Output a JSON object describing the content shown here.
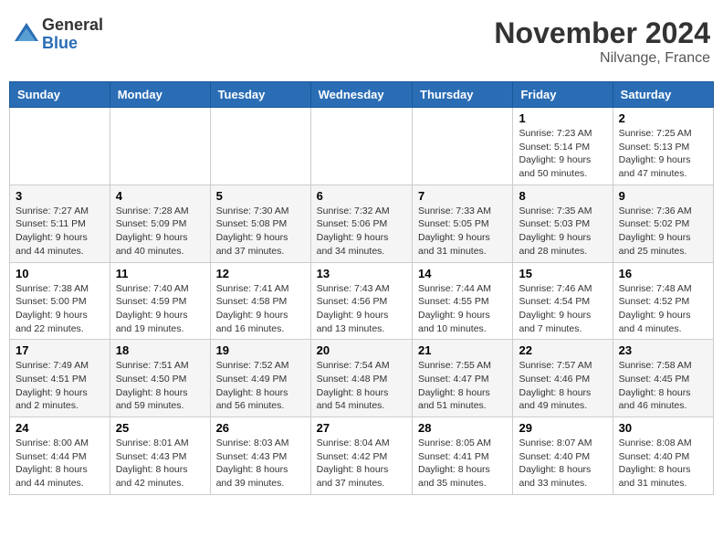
{
  "logo": {
    "general": "General",
    "blue": "Blue"
  },
  "title": "November 2024",
  "location": "Nilvange, France",
  "weekdays": [
    "Sunday",
    "Monday",
    "Tuesday",
    "Wednesday",
    "Thursday",
    "Friday",
    "Saturday"
  ],
  "weeks": [
    [
      null,
      null,
      null,
      null,
      null,
      {
        "day": "1",
        "sunrise": "Sunrise: 7:23 AM",
        "sunset": "Sunset: 5:14 PM",
        "daylight": "Daylight: 9 hours and 50 minutes."
      },
      {
        "day": "2",
        "sunrise": "Sunrise: 7:25 AM",
        "sunset": "Sunset: 5:13 PM",
        "daylight": "Daylight: 9 hours and 47 minutes."
      }
    ],
    [
      {
        "day": "3",
        "sunrise": "Sunrise: 7:27 AM",
        "sunset": "Sunset: 5:11 PM",
        "daylight": "Daylight: 9 hours and 44 minutes."
      },
      {
        "day": "4",
        "sunrise": "Sunrise: 7:28 AM",
        "sunset": "Sunset: 5:09 PM",
        "daylight": "Daylight: 9 hours and 40 minutes."
      },
      {
        "day": "5",
        "sunrise": "Sunrise: 7:30 AM",
        "sunset": "Sunset: 5:08 PM",
        "daylight": "Daylight: 9 hours and 37 minutes."
      },
      {
        "day": "6",
        "sunrise": "Sunrise: 7:32 AM",
        "sunset": "Sunset: 5:06 PM",
        "daylight": "Daylight: 9 hours and 34 minutes."
      },
      {
        "day": "7",
        "sunrise": "Sunrise: 7:33 AM",
        "sunset": "Sunset: 5:05 PM",
        "daylight": "Daylight: 9 hours and 31 minutes."
      },
      {
        "day": "8",
        "sunrise": "Sunrise: 7:35 AM",
        "sunset": "Sunset: 5:03 PM",
        "daylight": "Daylight: 9 hours and 28 minutes."
      },
      {
        "day": "9",
        "sunrise": "Sunrise: 7:36 AM",
        "sunset": "Sunset: 5:02 PM",
        "daylight": "Daylight: 9 hours and 25 minutes."
      }
    ],
    [
      {
        "day": "10",
        "sunrise": "Sunrise: 7:38 AM",
        "sunset": "Sunset: 5:00 PM",
        "daylight": "Daylight: 9 hours and 22 minutes."
      },
      {
        "day": "11",
        "sunrise": "Sunrise: 7:40 AM",
        "sunset": "Sunset: 4:59 PM",
        "daylight": "Daylight: 9 hours and 19 minutes."
      },
      {
        "day": "12",
        "sunrise": "Sunrise: 7:41 AM",
        "sunset": "Sunset: 4:58 PM",
        "daylight": "Daylight: 9 hours and 16 minutes."
      },
      {
        "day": "13",
        "sunrise": "Sunrise: 7:43 AM",
        "sunset": "Sunset: 4:56 PM",
        "daylight": "Daylight: 9 hours and 13 minutes."
      },
      {
        "day": "14",
        "sunrise": "Sunrise: 7:44 AM",
        "sunset": "Sunset: 4:55 PM",
        "daylight": "Daylight: 9 hours and 10 minutes."
      },
      {
        "day": "15",
        "sunrise": "Sunrise: 7:46 AM",
        "sunset": "Sunset: 4:54 PM",
        "daylight": "Daylight: 9 hours and 7 minutes."
      },
      {
        "day": "16",
        "sunrise": "Sunrise: 7:48 AM",
        "sunset": "Sunset: 4:52 PM",
        "daylight": "Daylight: 9 hours and 4 minutes."
      }
    ],
    [
      {
        "day": "17",
        "sunrise": "Sunrise: 7:49 AM",
        "sunset": "Sunset: 4:51 PM",
        "daylight": "Daylight: 9 hours and 2 minutes."
      },
      {
        "day": "18",
        "sunrise": "Sunrise: 7:51 AM",
        "sunset": "Sunset: 4:50 PM",
        "daylight": "Daylight: 8 hours and 59 minutes."
      },
      {
        "day": "19",
        "sunrise": "Sunrise: 7:52 AM",
        "sunset": "Sunset: 4:49 PM",
        "daylight": "Daylight: 8 hours and 56 minutes."
      },
      {
        "day": "20",
        "sunrise": "Sunrise: 7:54 AM",
        "sunset": "Sunset: 4:48 PM",
        "daylight": "Daylight: 8 hours and 54 minutes."
      },
      {
        "day": "21",
        "sunrise": "Sunrise: 7:55 AM",
        "sunset": "Sunset: 4:47 PM",
        "daylight": "Daylight: 8 hours and 51 minutes."
      },
      {
        "day": "22",
        "sunrise": "Sunrise: 7:57 AM",
        "sunset": "Sunset: 4:46 PM",
        "daylight": "Daylight: 8 hours and 49 minutes."
      },
      {
        "day": "23",
        "sunrise": "Sunrise: 7:58 AM",
        "sunset": "Sunset: 4:45 PM",
        "daylight": "Daylight: 8 hours and 46 minutes."
      }
    ],
    [
      {
        "day": "24",
        "sunrise": "Sunrise: 8:00 AM",
        "sunset": "Sunset: 4:44 PM",
        "daylight": "Daylight: 8 hours and 44 minutes."
      },
      {
        "day": "25",
        "sunrise": "Sunrise: 8:01 AM",
        "sunset": "Sunset: 4:43 PM",
        "daylight": "Daylight: 8 hours and 42 minutes."
      },
      {
        "day": "26",
        "sunrise": "Sunrise: 8:03 AM",
        "sunset": "Sunset: 4:43 PM",
        "daylight": "Daylight: 8 hours and 39 minutes."
      },
      {
        "day": "27",
        "sunrise": "Sunrise: 8:04 AM",
        "sunset": "Sunset: 4:42 PM",
        "daylight": "Daylight: 8 hours and 37 minutes."
      },
      {
        "day": "28",
        "sunrise": "Sunrise: 8:05 AM",
        "sunset": "Sunset: 4:41 PM",
        "daylight": "Daylight: 8 hours and 35 minutes."
      },
      {
        "day": "29",
        "sunrise": "Sunrise: 8:07 AM",
        "sunset": "Sunset: 4:40 PM",
        "daylight": "Daylight: 8 hours and 33 minutes."
      },
      {
        "day": "30",
        "sunrise": "Sunrise: 8:08 AM",
        "sunset": "Sunset: 4:40 PM",
        "daylight": "Daylight: 8 hours and 31 minutes."
      }
    ]
  ]
}
